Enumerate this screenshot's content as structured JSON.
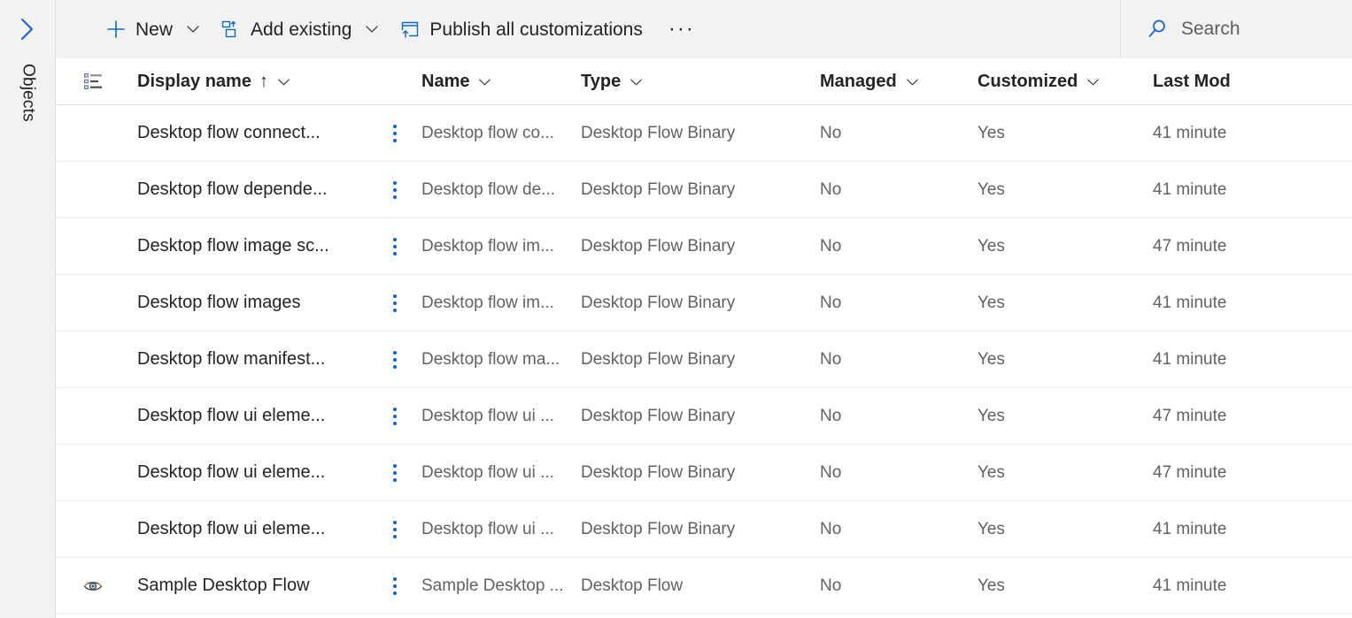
{
  "sidebar": {
    "expand_icon": "chevron-right-icon",
    "label": "Objects"
  },
  "commandbar": {
    "buttons": [
      {
        "id": "new",
        "icon": "plus-icon",
        "label": "New",
        "has_caret": true
      },
      {
        "id": "add-existing",
        "icon": "add-existing-icon",
        "label": "Add existing",
        "has_caret": true
      },
      {
        "id": "publish-all",
        "icon": "publish-icon",
        "label": "Publish all customizations",
        "has_caret": false
      }
    ],
    "overflow_label": "···",
    "overflow_name": "more-commands-icon"
  },
  "search": {
    "icon": "search-icon",
    "placeholder": "Search"
  },
  "grid": {
    "view_selector_icon": "list-view-icon",
    "columns": [
      {
        "key": "display_name",
        "label": "Display name",
        "sorted": true,
        "sort_glyph": "↑"
      },
      {
        "key": "name",
        "label": "Name",
        "sorted": false
      },
      {
        "key": "type",
        "label": "Type",
        "sorted": false
      },
      {
        "key": "managed",
        "label": "Managed",
        "sorted": false
      },
      {
        "key": "customized",
        "label": "Customized",
        "sorted": false
      },
      {
        "key": "last_modified",
        "label": "Last Mod",
        "sorted": false
      }
    ],
    "rows": [
      {
        "icon": "",
        "display_name": "Desktop flow connect...",
        "name": "Desktop flow co...",
        "type": "Desktop Flow Binary",
        "managed": "No",
        "customized": "Yes",
        "last_modified": "41 minute"
      },
      {
        "icon": "",
        "display_name": "Desktop flow depende...",
        "name": "Desktop flow de...",
        "type": "Desktop Flow Binary",
        "managed": "No",
        "customized": "Yes",
        "last_modified": "41 minute"
      },
      {
        "icon": "",
        "display_name": "Desktop flow image sc...",
        "name": "Desktop flow im...",
        "type": "Desktop Flow Binary",
        "managed": "No",
        "customized": "Yes",
        "last_modified": "47 minute"
      },
      {
        "icon": "",
        "display_name": "Desktop flow images",
        "name": "Desktop flow im...",
        "type": "Desktop Flow Binary",
        "managed": "No",
        "customized": "Yes",
        "last_modified": "41 minute"
      },
      {
        "icon": "",
        "display_name": "Desktop flow manifest...",
        "name": "Desktop flow ma...",
        "type": "Desktop Flow Binary",
        "managed": "No",
        "customized": "Yes",
        "last_modified": "41 minute"
      },
      {
        "icon": "",
        "display_name": "Desktop flow ui eleme...",
        "name": "Desktop flow ui ...",
        "type": "Desktop Flow Binary",
        "managed": "No",
        "customized": "Yes",
        "last_modified": "47 minute"
      },
      {
        "icon": "",
        "display_name": "Desktop flow ui eleme...",
        "name": "Desktop flow ui ...",
        "type": "Desktop Flow Binary",
        "managed": "No",
        "customized": "Yes",
        "last_modified": "47 minute"
      },
      {
        "icon": "",
        "display_name": "Desktop flow ui eleme...",
        "name": "Desktop flow ui ...",
        "type": "Desktop Flow Binary",
        "managed": "No",
        "customized": "Yes",
        "last_modified": "41 minute"
      },
      {
        "icon": "eye-icon",
        "display_name": "Sample Desktop Flow",
        "name": "Sample Desktop ...",
        "type": "Desktop Flow",
        "managed": "No",
        "customized": "Yes",
        "last_modified": "41 minute"
      }
    ]
  },
  "colors": {
    "accent": "#0f6cbd",
    "kebab": "#1062d4",
    "commandbar_bg": "#f3f2f1",
    "text_primary": "#242424",
    "text_secondary": "#616161",
    "divider": "#e1dfdd"
  }
}
